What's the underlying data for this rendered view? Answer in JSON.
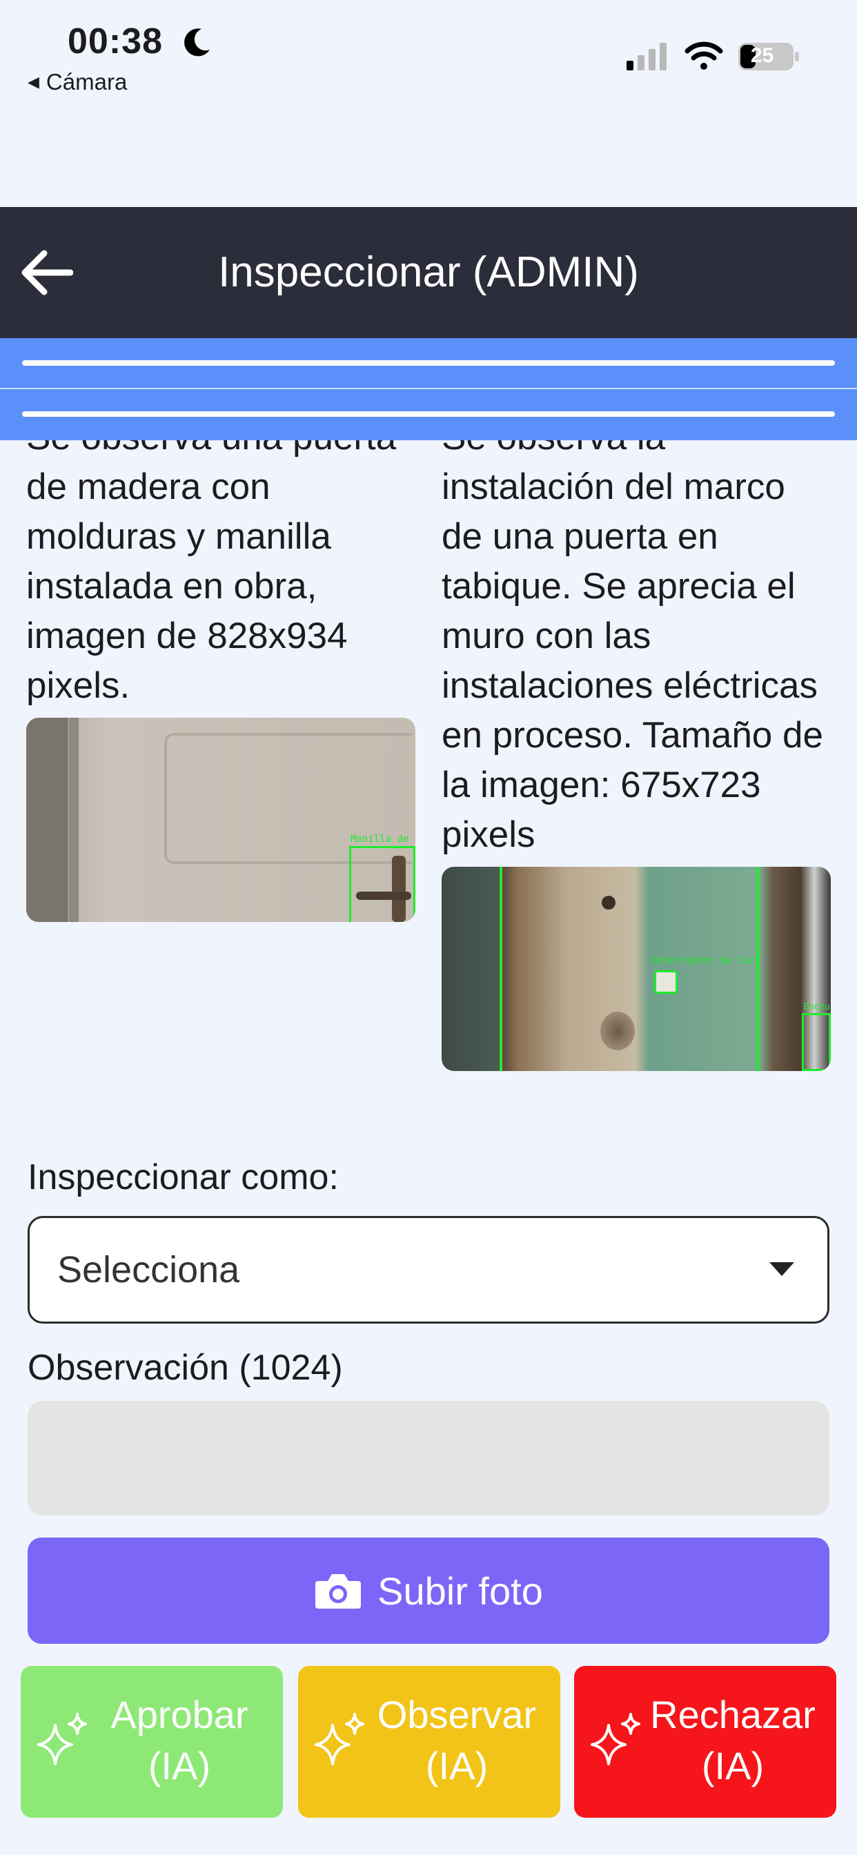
{
  "status_bar": {
    "time": "00:38",
    "back_app": "Cámara",
    "battery": "25"
  },
  "header": {
    "title": "Inspeccionar (ADMIN)"
  },
  "items": [
    {
      "description": "Se observa una puerta de madera con molduras y manilla instalada en obra, imagen de 828x934 pixels.",
      "detection_label": "Manilla de l"
    },
    {
      "description": "Se observa la instalación del marco de una puerta en tabique. Se aprecia el muro con las instalaciones eléctricas en proceso. Tamaño de la imagen: 675x723 pixels",
      "detection_label": "Interruptor de luz",
      "detection_label_2": "Enchu"
    }
  ],
  "form": {
    "inspect_label": "Inspeccionar como:",
    "inspect_value": "Selecciona",
    "observation_label": "Observación (1024)",
    "observation_value": ""
  },
  "actions": {
    "upload_label": "Subir foto",
    "approve_label": "Aprobar (IA)",
    "observe_label": "Observar (IA)",
    "reject_label": "Rechazar (IA)"
  },
  "colors": {
    "header_bg": "#2b2d3a",
    "blue_bar": "#5b8ff9",
    "upload": "#7b66f7",
    "approve": "#8ee876",
    "observe": "#f2c418",
    "reject": "#f5151a"
  }
}
